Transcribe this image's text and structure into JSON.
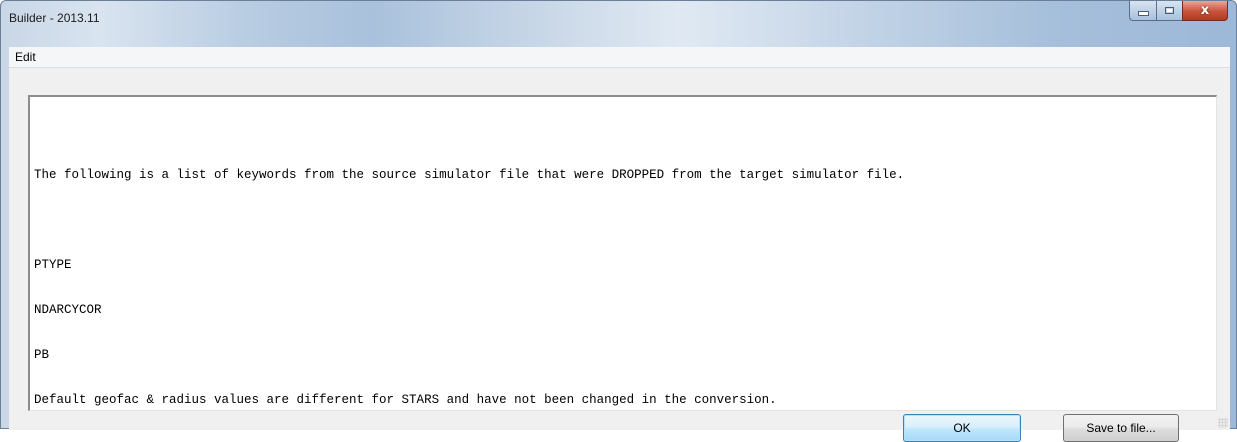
{
  "window": {
    "title": "Builder - 2013.11",
    "close_glyph": "x"
  },
  "menubar": {
    "items": [
      {
        "label": "Edit"
      }
    ]
  },
  "message": {
    "lines": [
      "The following is a list of keywords from the source simulator file that were DROPPED from the target simulator file.",
      "",
      "PTYPE",
      "NDARCYCOR",
      "PB",
      "Default geofac & radius values are different for STARS and have not been changed in the conversion."
    ]
  },
  "buttons": {
    "ok_label": "OK",
    "save_label": "Save to file..."
  }
}
